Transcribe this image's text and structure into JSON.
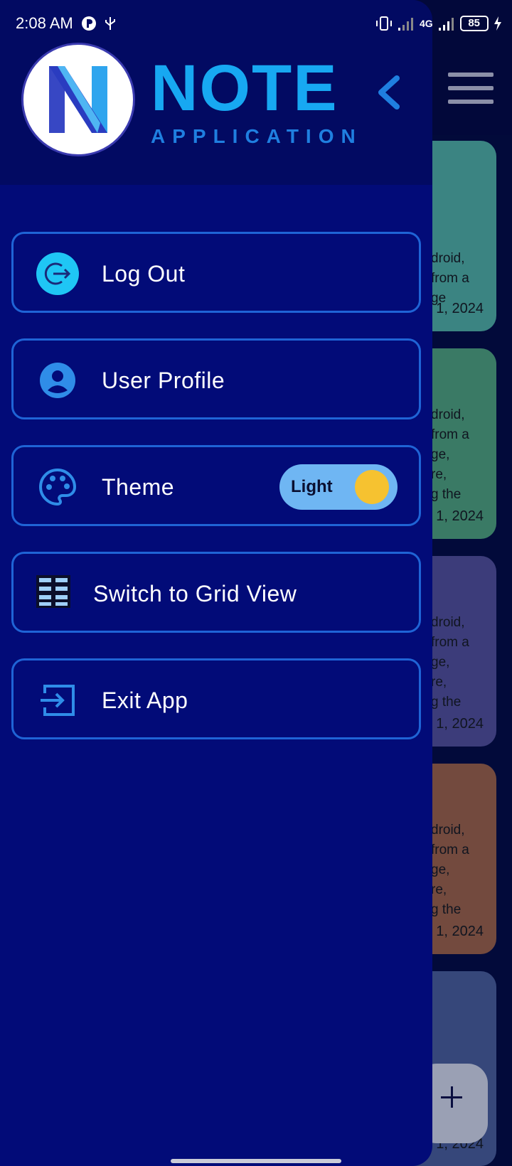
{
  "status_bar": {
    "time": "2:08 AM",
    "network": "4G",
    "battery": "85"
  },
  "header": {
    "logo_letter": "N",
    "title": "NOTE",
    "subtitle": "APPLICATION"
  },
  "menu": {
    "items": [
      {
        "label": "Log Out",
        "icon": "logout-icon"
      },
      {
        "label": "User Profile",
        "icon": "account-circle-icon"
      },
      {
        "label": "Theme",
        "icon": "palette-icon"
      },
      {
        "label": "Switch to Grid View",
        "icon": "grid-view-icon"
      },
      {
        "label": "Exit App",
        "icon": "exit-icon"
      }
    ],
    "theme_toggle_label": "Light"
  },
  "notes": [
    {
      "snippet": "droid,\nfrom a\nge",
      "date": "1, 2024",
      "color": "#3b8482"
    },
    {
      "snippet": "droid,\nfrom a\nge,\nre,\ng the",
      "date": "1, 2024",
      "color": "#3a7a65"
    },
    {
      "snippet": "droid,\nfrom a\nge,\nre,\ng the",
      "date": "1, 2024",
      "color": "#3c3c7a"
    },
    {
      "snippet": "droid,\nfrom a\nge,\nre,\ng the",
      "date": "1, 2024",
      "color": "#734a3e"
    },
    {
      "snippet": "",
      "date": "1, 2024",
      "color": "#36477a"
    }
  ],
  "colors": {
    "drawer_bg": "#020b78",
    "header_bg": "#020a62",
    "accent": "#17a8f2",
    "border": "#1f64d6",
    "toggle_bg": "#6fb6f3",
    "toggle_knob": "#f6c230"
  }
}
